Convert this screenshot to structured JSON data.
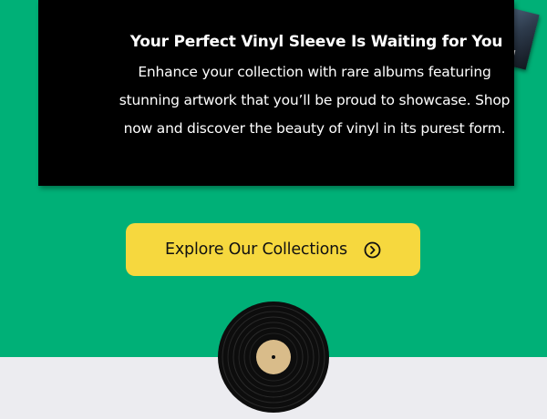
{
  "promo": {
    "headline": "Your Perfect Vinyl Sleeve Is Waiting for You",
    "body_lines": [
      "Enhance your collection with rare albums featuring",
      "stunning artwork that you’ll be proud to showcase. Shop",
      "now and discover the beauty of vinyl in its purest form."
    ]
  },
  "cta": {
    "label": "Explore Our Collections",
    "icon": "chevron-right-circle-icon"
  },
  "colors": {
    "background": "#00B077",
    "card": "#000000",
    "button": "#F6D83E",
    "bottom_band": "#ECECF0",
    "record_label": "#D9BC8A"
  },
  "icons": {
    "vinyl": "vinyl-record-icon"
  }
}
